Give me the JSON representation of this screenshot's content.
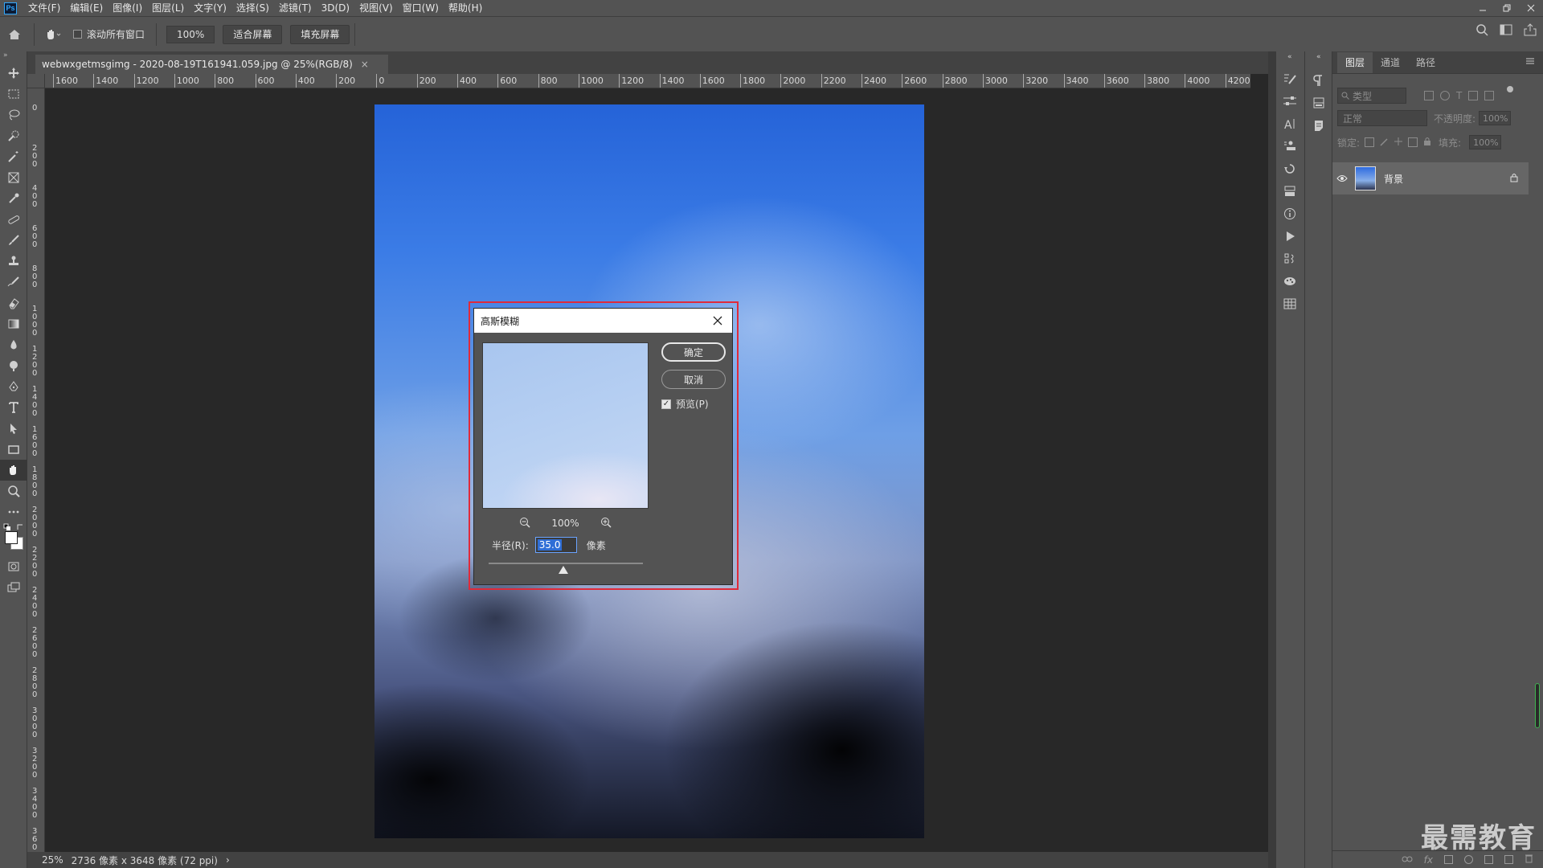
{
  "menubar": {
    "logo": "Ps",
    "items": [
      "文件(F)",
      "编辑(E)",
      "图像(I)",
      "图层(L)",
      "文字(Y)",
      "选择(S)",
      "滤镜(T)",
      "3D(D)",
      "视图(V)",
      "窗口(W)",
      "帮助(H)"
    ],
    "window_controls": [
      "minimize-icon",
      "restore-icon",
      "close-icon"
    ]
  },
  "options": {
    "scroll_all_label": "滚动所有窗口",
    "zoom_value": "100%",
    "fit_screen": "适合屏幕",
    "fill_screen": "填充屏幕"
  },
  "document": {
    "tab_title": "webwxgetmsgimg - 2020-08-19T161941.059.jpg @ 25%(RGB/8)",
    "tab_close": "×"
  },
  "ruler": {
    "h_ticks": [
      "1600",
      "1400",
      "1200",
      "1000",
      "800",
      "600",
      "400",
      "200",
      "0",
      "200",
      "400",
      "600",
      "800",
      "1000",
      "1200",
      "1400",
      "1600",
      "1800",
      "2000",
      "2200",
      "2400",
      "2600",
      "2800",
      "3000",
      "3200",
      "3400",
      "3600",
      "3800",
      "4000",
      "4200"
    ],
    "v_ticks": [
      "0",
      "2 0 0",
      "4 0 0",
      "6 0 0",
      "8 0 0",
      "1 0 0 0",
      "1 2 0 0",
      "1 4 0 0",
      "1 6 0 0",
      "1 8 0 0",
      "2 0 0 0",
      "2 2 0 0",
      "2 4 0 0",
      "2 6 0 0",
      "2 8 0 0",
      "3 0 0 0",
      "3 2 0 0",
      "3 4 0 0",
      "3 6 0 0"
    ]
  },
  "dialog": {
    "title": "高斯模糊",
    "ok": "确定",
    "cancel": "取消",
    "preview_label": "预览(P)",
    "preview_checked": true,
    "zoom": "100%",
    "radius_label": "半径(R):",
    "radius_value": "35.0",
    "radius_unit": "像素",
    "highlight_color": "#e02a3a"
  },
  "status": {
    "zoom": "25%",
    "info": "2736 像素 x 3648 像素 (72 ppi)",
    "arrow": "›"
  },
  "layers_panel": {
    "tabs": [
      "图层",
      "通道",
      "路径"
    ],
    "active_tab": "图层",
    "filter_placeholder": "类型",
    "blend_mode": "正常",
    "opacity_label": "不透明度:",
    "opacity_value": "100%",
    "lock_label": "锁定:",
    "fill_label": "填充:",
    "fill_value": "100%",
    "layers": [
      {
        "name": "背景",
        "visible": true,
        "locked": true
      }
    ]
  },
  "watermark": "最需教育"
}
